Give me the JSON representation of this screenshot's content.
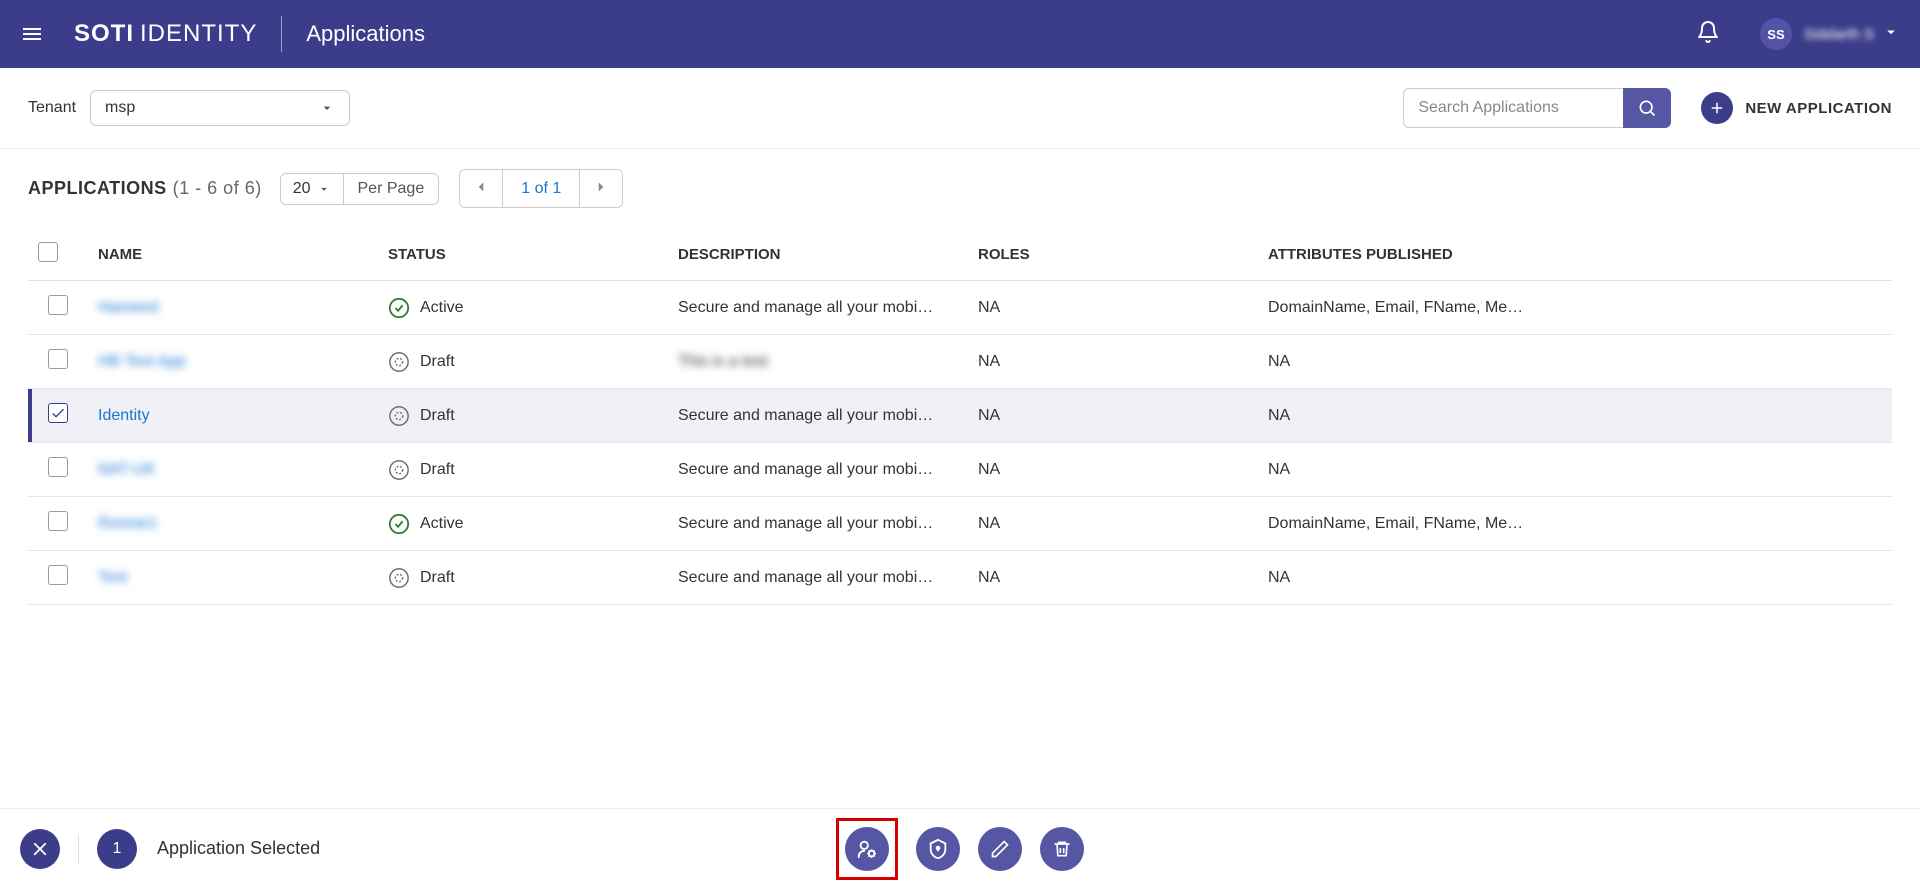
{
  "header": {
    "logo_main": "SOTI",
    "logo_sub": "IDENTITY",
    "title": "Applications",
    "user_initials": "SS",
    "user_name": "Siddarth S"
  },
  "toolbar": {
    "tenant_label": "Tenant",
    "tenant_value": "msp",
    "search_placeholder": "Search Applications",
    "new_app_label": "NEW APPLICATION"
  },
  "list": {
    "title": "APPLICATIONS",
    "count_info": "(1 - 6 of 6)",
    "page_size_value": "20",
    "page_size_label": "Per Page",
    "pager_info": "1 of 1"
  },
  "columns": {
    "name": "NAME",
    "status": "STATUS",
    "description": "DESCRIPTION",
    "roles": "ROLES",
    "attributes": "ATTRIBUTES PUBLISHED"
  },
  "rows": [
    {
      "selected": false,
      "name": "Hameed",
      "blur": true,
      "status": "Active",
      "status_type": "active",
      "description": "Secure and manage all your mobi…",
      "roles": "NA",
      "attributes": "DomainName, Email, FName, Me…"
    },
    {
      "selected": false,
      "name": "HB Test App",
      "blur": true,
      "status": "Draft",
      "status_type": "draft",
      "description": "This is a test",
      "desc_blur": true,
      "roles": "NA",
      "attributes": "NA"
    },
    {
      "selected": true,
      "name": "Identity",
      "blur": false,
      "status": "Draft",
      "status_type": "draft",
      "description": "Secure and manage all your mobi…",
      "roles": "NA",
      "attributes": "NA"
    },
    {
      "selected": false,
      "name": "NAT-UK",
      "blur": true,
      "status": "Draft",
      "status_type": "draft",
      "description": "Secure and manage all your mobi…",
      "roles": "NA",
      "attributes": "NA"
    },
    {
      "selected": false,
      "name": "Ronnie1",
      "blur": true,
      "status": "Active",
      "status_type": "active",
      "description": "Secure and manage all your mobi…",
      "roles": "NA",
      "attributes": "DomainName, Email, FName, Me…"
    },
    {
      "selected": false,
      "name": "Test",
      "blur": true,
      "status": "Draft",
      "status_type": "draft",
      "description": "Secure and manage all your mobi…",
      "roles": "NA",
      "attributes": "NA"
    }
  ],
  "action_bar": {
    "selected_count": "1",
    "selected_label": "Application Selected"
  }
}
